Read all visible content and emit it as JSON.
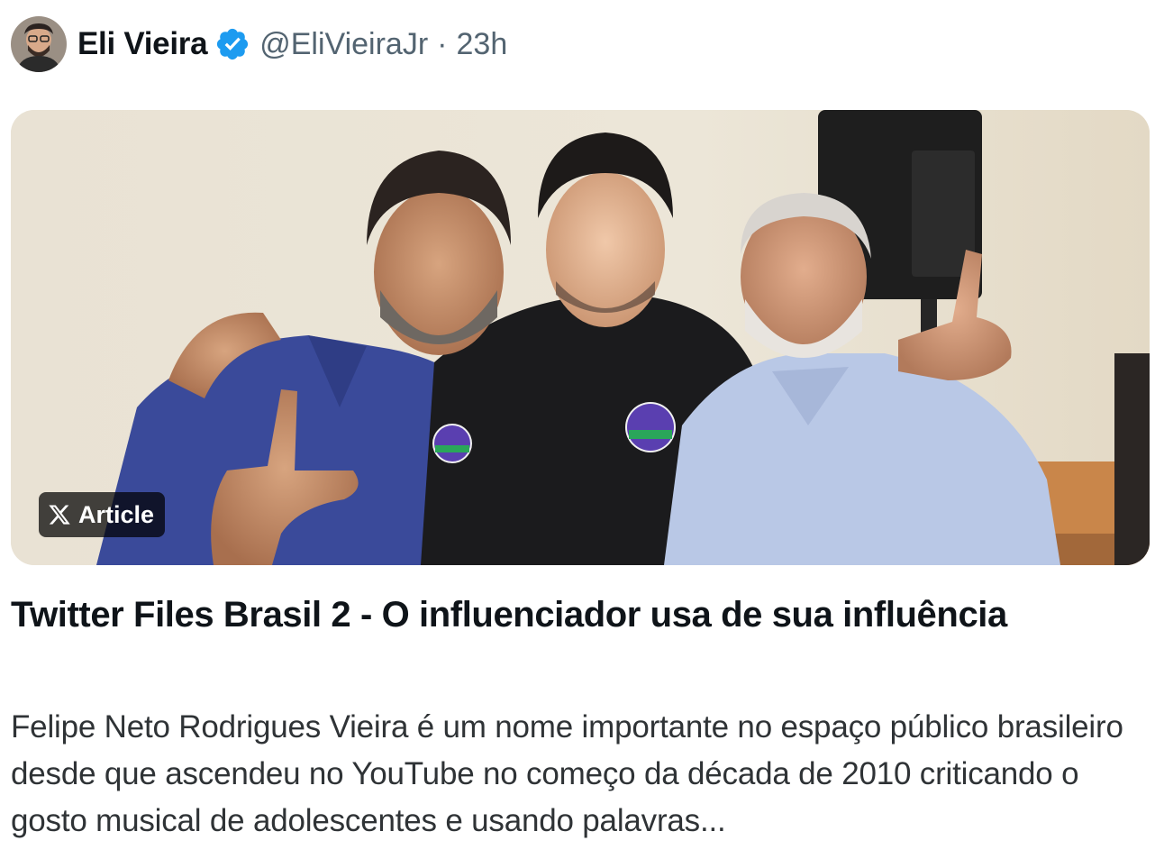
{
  "tweet": {
    "author": {
      "display_name": "Eli Vieira",
      "verified": true,
      "handle": "@EliVieiraJr",
      "separator": "·",
      "timestamp": "23h"
    },
    "card": {
      "badge_label": "Article",
      "title": "Twitter Files Brasil 2 - O influenciador usa de sua influência",
      "excerpt": "Felipe Neto Rodrigues Vieira é um nome importante no espaço público brasileiro desde que ascendeu no YouTube no começo da década de 2010 criticando o gosto musical de adolescentes e usando palavras..."
    }
  },
  "colors": {
    "text_primary": "#0f1419",
    "text_secondary": "#536471",
    "verified_blue": "#1d9bf0"
  },
  "icons": {
    "verified": "verified-badge-icon",
    "x_logo": "x-logo-icon"
  }
}
